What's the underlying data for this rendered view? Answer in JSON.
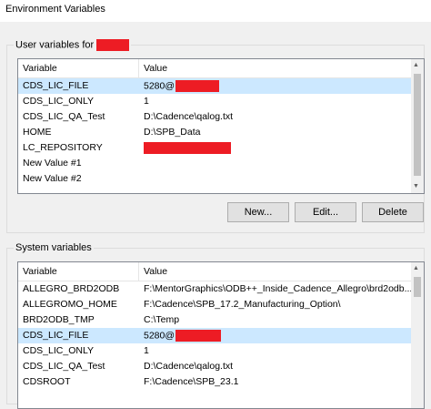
{
  "window": {
    "title": "Environment Variables"
  },
  "user_section": {
    "label": "User variables for",
    "columns": {
      "variable": "Variable",
      "value": "Value"
    },
    "rows": [
      {
        "variable": "CDS_LIC_FILE",
        "value": "5280@"
      },
      {
        "variable": "CDS_LIC_ONLY",
        "value": "1"
      },
      {
        "variable": "CDS_LIC_QA_Test",
        "value": "D:\\Cadence\\qalog.txt"
      },
      {
        "variable": "HOME",
        "value": "D:\\SPB_Data"
      },
      {
        "variable": "LC_REPOSITORY",
        "value": ""
      },
      {
        "variable": "New Value #1",
        "value": ""
      },
      {
        "variable": "New Value #2",
        "value": ""
      }
    ],
    "buttons": {
      "new": "New...",
      "edit": "Edit...",
      "delete": "Delete"
    }
  },
  "system_section": {
    "label": "System variables",
    "columns": {
      "variable": "Variable",
      "value": "Value"
    },
    "rows": [
      {
        "variable": "ALLEGRO_BRD2ODB",
        "value": "F:\\MentorGraphics\\ODB++_Inside_Cadence_Allegro\\brd2odb..."
      },
      {
        "variable": "ALLEGROMO_HOME",
        "value": "F:\\Cadence\\SPB_17.2_Manufacturing_Option\\"
      },
      {
        "variable": "BRD2ODB_TMP",
        "value": "C:\\Temp"
      },
      {
        "variable": "CDS_LIC_FILE",
        "value": "5280@"
      },
      {
        "variable": "CDS_LIC_ONLY",
        "value": "1"
      },
      {
        "variable": "CDS_LIC_QA_Test",
        "value": "D:\\Cadence\\qalog.txt"
      },
      {
        "variable": "CDSROOT",
        "value": "F:\\Cadence\\SPB_23.1"
      }
    ]
  },
  "colors": {
    "selection": "#cce8ff",
    "redaction": "#ed1c24"
  }
}
